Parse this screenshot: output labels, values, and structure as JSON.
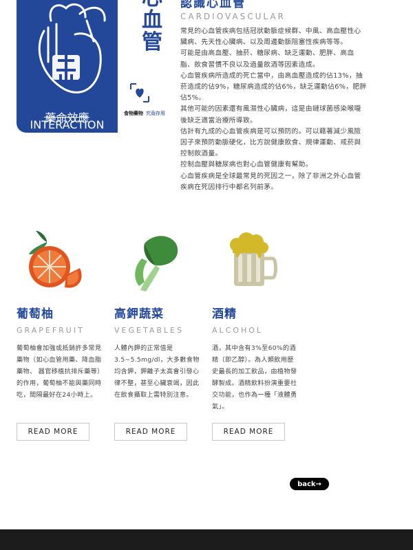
{
  "hero": {
    "caption_cn": "藥命效應",
    "caption_en": "INTERACTION"
  },
  "side_title": "心血管",
  "side_label": {
    "primary": "食物藥物",
    "secondary": "究竟存用"
  },
  "section": {
    "title": "認識心血管",
    "subtitle": "CARDIOVASCULAR",
    "paragraphs": [
      "常見的心血管疾病包括冠狀動脈症候群、中風、高血壓性心臟病、先天性心臟病、以及周邊動脈阻塞性疾病等等。",
      "可能是由高血壓、抽菸、糖尿病、缺乏運動、肥胖、高血脂、飲食習慣不良以及過量飲酒等因素造成。",
      "心血管疾病所造成的死亡當中，由高血壓造成的佔13%，抽菸造成的佔9%，糖尿病造成的佔6%，缺乏運動佔6%，肥胖佔5%。",
      "其他可能的因素還有風濕性心臟病，這是由鏈球菌感染喉嚨後缺乏適當治療所導致。",
      "估計有九成的心血管疾病是可以預防的。可以藉著減少風險因子來預防動脈硬化，比方說健康飲食、規律運動、戒菸與控制飲酒量。",
      "控制血壓與糖尿病也對心血管健康有幫助。",
      "心血管疾病是全球最常見的死因之一，除了非洲之外心血管疾病在死因排行中都名列前茅。"
    ]
  },
  "items": [
    {
      "name": "葡萄柚",
      "en": "GRAPEFRUIT",
      "desc": "葡萄柚會加強或抵銷許多常見藥物（如心血管用藥、降血脂藥物、 器官移植抗排斥藥等）的作用，葡萄柚不能與藥同時吃，間隔最好在24小時上。",
      "button": "READ MORE",
      "icon": "grapefruit-icon"
    },
    {
      "name": "高鉀蔬菜",
      "en": "VEGETABLES",
      "desc": "人體內鉀的正常值是3.5~5.5mg/dl，大多數食物均含鉀，鉀離子太高會引發心律不整，甚至心臟衰竭，因此在飲食攝取上需特別注意。",
      "button": "READ MORE",
      "icon": "vegetable-icon"
    },
    {
      "name": "酒精",
      "en": "ALCOHOL",
      "desc": "酒，其中含有3%至60%的酒精（即乙醇）。為人類飲用歷史最長的加工飲品，由植物發酵製成。酒精飲料扮演重要社交功能，也作為一種「液體勇氣」。",
      "button": "READ MORE",
      "icon": "beer-mug-icon"
    }
  ],
  "back_label": "back→",
  "colors": {
    "brand_blue": "#23489a",
    "footer": "#1c1c1c"
  }
}
